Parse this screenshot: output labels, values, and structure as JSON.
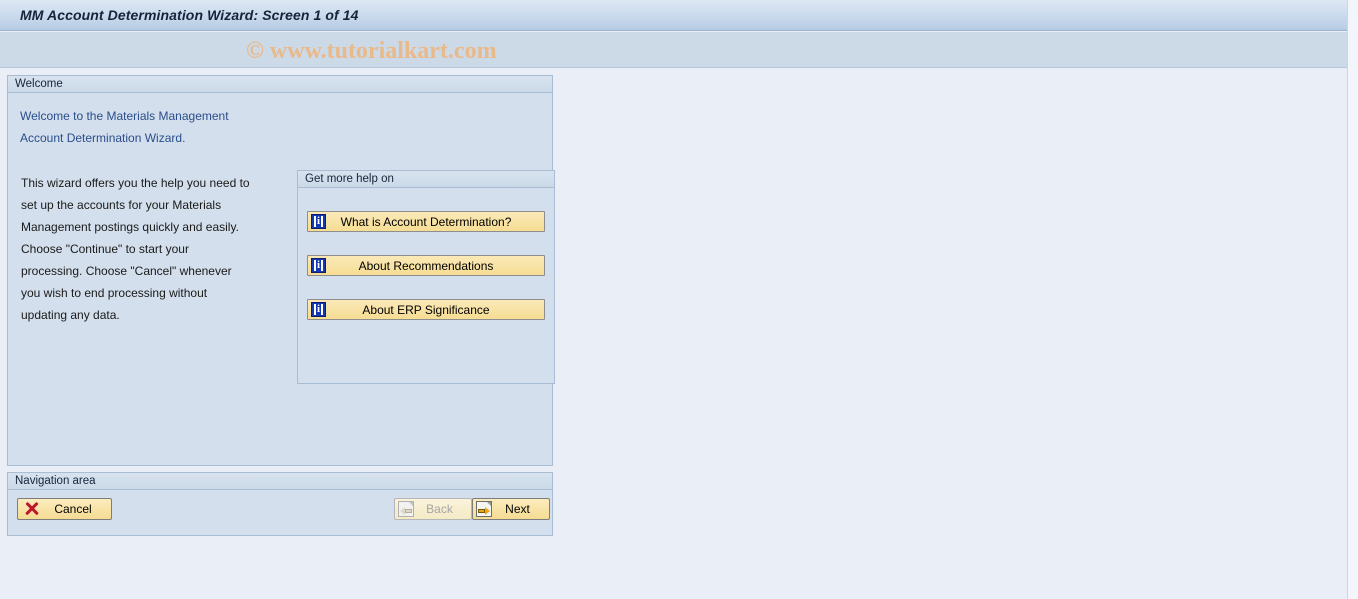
{
  "window": {
    "title": "MM Account Determination Wizard: Screen 1 of 14",
    "watermark": "© www.tutorialkart.com"
  },
  "welcome_panel": {
    "header": "Welcome",
    "heading_line1": "Welcome to the Materials Management",
    "heading_line2": "Account Determination Wizard.",
    "body_paragraph_1": "This wizard offers you the help you need to set up the accounts for your Materials Management postings quickly and easily.",
    "body_paragraph_2": "Choose \"Continue\" to start your processing. Choose \"Cancel\" whenever you wish to end processing without updating any data."
  },
  "help_panel": {
    "header": "Get more help on",
    "buttons": [
      {
        "label": "What is Account Determination?",
        "icon": "info-icon"
      },
      {
        "label": "About Recommendations",
        "icon": "info-icon"
      },
      {
        "label": "About ERP Significance",
        "icon": "info-icon"
      }
    ]
  },
  "navigation": {
    "header": "Navigation area",
    "cancel_label": "Cancel",
    "back_label": "Back",
    "next_label": "Next"
  },
  "colors": {
    "page_background": "#e9eef7",
    "panel_background": "#d3dfec",
    "panel_border": "#a8bdd4",
    "title_text": "#16243a",
    "heading_link": "#2b4e8c",
    "button_yellow": "#f8e3a6",
    "info_icon_blue": "#1438b4",
    "cancel_red": "#c0162c",
    "arrow_yellow": "#e8a817",
    "watermark_orange": "#eab989"
  }
}
